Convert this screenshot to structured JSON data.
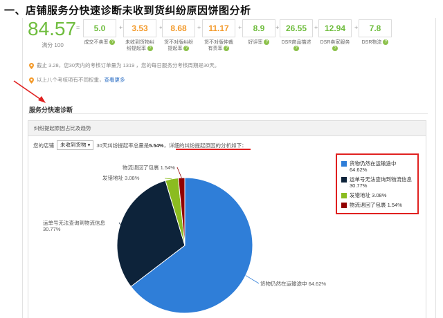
{
  "heading": "一、店铺服务分快速诊断未收到货纠纷原因饼图分析",
  "score": {
    "value": "84.57",
    "label": "满分 100"
  },
  "metrics": [
    {
      "value": "5.0",
      "label": "成交不卖率",
      "color": "green"
    },
    {
      "value": "3.53",
      "label": "未收到货物纠纷提起率",
      "color": "orange"
    },
    {
      "value": "8.68",
      "label": "货不对版纠纷提起率",
      "color": "orange"
    },
    {
      "value": "11.17",
      "label": "货不对版仲裁有责率",
      "color": "orange"
    },
    {
      "value": "8.9",
      "label": "好评率",
      "color": "green"
    },
    {
      "value": "26.55",
      "label": "DSR商品描述",
      "color": "green"
    },
    {
      "value": "12.94",
      "label": "DSR卖家服务",
      "color": "green"
    },
    {
      "value": "7.8",
      "label": "DSR物流",
      "color": "green"
    }
  ],
  "operators": [
    "=",
    "+",
    "+",
    "+",
    "+",
    "+",
    "+",
    "+"
  ],
  "notes": {
    "line1": "截止 3.28，您30天内的考核订单量为 1319 ，您的每日服务分考核周期是30天。",
    "line2": "以上八个考核项有不同权重，",
    "line2_link": "查看更多"
  },
  "section_title": "服务分快速诊断",
  "card_title": "纠纷提起原因占比及趋势",
  "filter": {
    "prefix": "您的店铺",
    "selected": "未收到货物",
    "middle": "30天纠纷提起率总量是",
    "rate": "5.54%",
    "suffix": "，详细的纠纷提起原因的分析如下："
  },
  "chart_data": {
    "type": "pie",
    "slices": [
      {
        "name": "货物仍然在运输途中",
        "value": 64.62,
        "label": "64.62%",
        "color": "#2f7ed8"
      },
      {
        "name": "运单号无法查询到物流信息",
        "value": 30.77,
        "label": "30.77%",
        "color": "#0d233a"
      },
      {
        "name": "发错地址",
        "value": 3.08,
        "label": "3.08%",
        "color": "#8bbc21"
      },
      {
        "name": "物流退回了包裹",
        "value": 1.54,
        "label": "1.54%",
        "color": "#910000"
      }
    ],
    "legend": "right"
  }
}
